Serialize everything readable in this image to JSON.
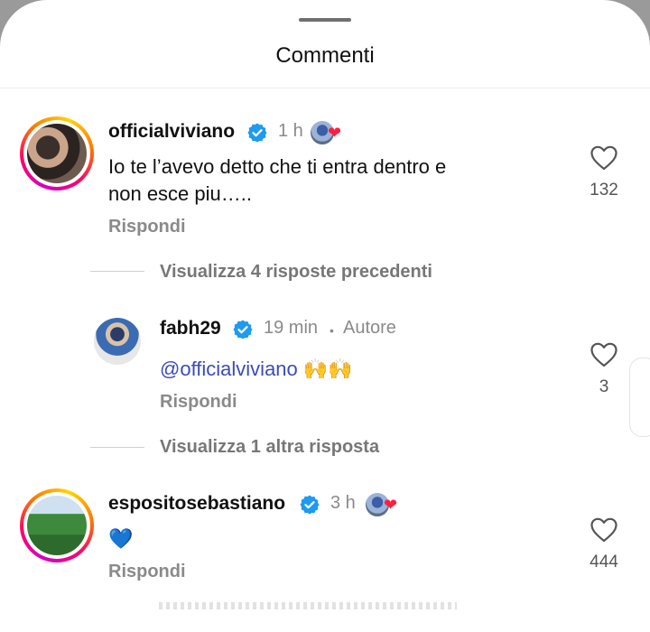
{
  "sheet": {
    "title": "Commenti"
  },
  "comments": [
    {
      "username": "officialviviano",
      "time": "1 h",
      "text_line1": "Io te l’avevo detto che ti entra dentro e",
      "text_line2": "non esce piu…..",
      "reply_label": "Rispondi",
      "likes": "132"
    },
    {
      "thread_label": "Visualizza 4 risposte precedenti"
    },
    {
      "username": "fabh29",
      "time": "19 min",
      "separator": "•",
      "author_badge": "Autore",
      "mention": "@officialviviano",
      "emoji": "🙌🙌",
      "reply_label": "Rispondi",
      "likes": "3"
    },
    {
      "thread_label": "Visualizza 1 altra risposta"
    },
    {
      "username": "espositosebastiano",
      "time": "3 h",
      "emoji": "💙",
      "reply_label": "Rispondi",
      "likes": "444"
    }
  ],
  "colors": {
    "verified": "#1d9bf0",
    "liked_heart": "#ff1e3c",
    "mention": "#3b4cb8"
  },
  "icons": {
    "verified": "verified-badge-icon",
    "like": "heart-outline-icon",
    "liked_by_author": "red-heart-icon"
  }
}
